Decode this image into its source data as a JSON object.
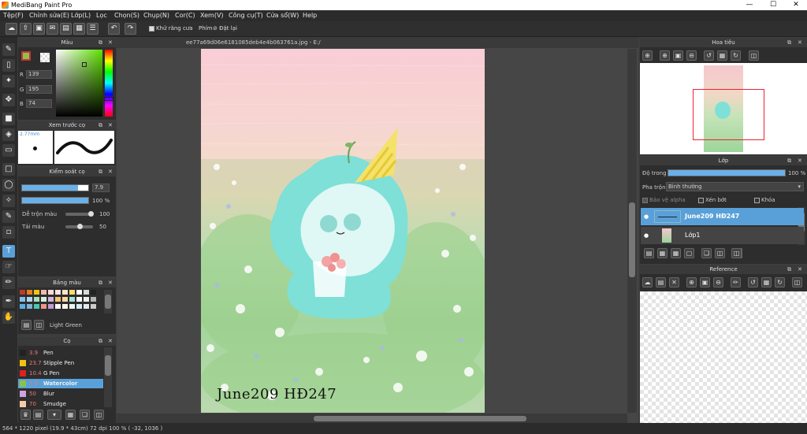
{
  "window": {
    "title": "MediBang Paint Pro"
  },
  "menu": [
    "Tệp(F)",
    "Chỉnh sửa(E)",
    "Lớp(L)",
    "Lọc",
    "Chọn(S)",
    "Chụp(N)",
    "Cor(C)",
    "Xem(V)",
    "Công cụ(T)",
    "Cửa sổ(W)",
    "Help"
  ],
  "toolbar": {
    "antialias_label": "Khử răng cưa",
    "key_label": "Phím",
    "reset_label": "Đặt lại"
  },
  "document": {
    "tab_title": "ee77a69d06e6181085deb4e4b063761a.jpg - E:/"
  },
  "color_panel": {
    "title": "Màu",
    "r": "139",
    "g": "195",
    "b": "74",
    "r_label": "R",
    "g_label": "G",
    "b_label": "B",
    "current_color": "#8bc34a"
  },
  "brush_preview": {
    "title": "Xem trước cọ",
    "size": "2.77mm"
  },
  "brush_control": {
    "title": "Kiểm soát cọ",
    "size_value": "7.9",
    "opacity_value": "100 %",
    "blend_label": "Dễ trộn màu",
    "blend_value": "100",
    "reload_label": "Tải màu",
    "reload_value": "50",
    "size_fill": 0.85,
    "opacity_fill": 1.0
  },
  "palette": {
    "title": "Bảng màu",
    "selected_name": "Light Green",
    "colors": [
      "#c0392b",
      "#e67e22",
      "#f1c40f",
      "#f5b7b1",
      "#fadbd8",
      "#fde2e4",
      "#fbe7c6",
      "#f7dc6f",
      "#ffffff",
      "#d5d8dc",
      "#222222",
      "#85c1e9",
      "#aed6f1",
      "#a9dfbf",
      "#d4efdf",
      "#d2b4de",
      "#f8c471",
      "#fad7a0",
      "#a3e4d7",
      "#ffffff",
      "#eeeeee",
      "#b3b6b7",
      "#5dade2",
      "#7fb3d5",
      "#48c9b0",
      "#f1948a",
      "#c39bd3",
      "#f7f9f9",
      "#fef9e7",
      "#e8f8f5",
      "#d6eaf8",
      "#e5e7e9",
      "#cccccc"
    ]
  },
  "brushes": {
    "title": "Cọ",
    "items": [
      {
        "size": "3.9",
        "name": "Pen",
        "color": "#222222"
      },
      {
        "size": "23.7",
        "name": "Stipple Pen",
        "color": "#f1c40f"
      },
      {
        "size": "10.4",
        "name": "G Pen",
        "color": "#e02020"
      },
      {
        "size": "7.9",
        "name": "Watercolor",
        "color": "#8bc34a"
      },
      {
        "size": "50",
        "name": "Blur",
        "color": "#d0a0e0"
      },
      {
        "size": "70",
        "name": "Smudge",
        "color": "#f5cba7"
      }
    ],
    "selected_index": 3
  },
  "navigator": {
    "title": "Hoa tiêu"
  },
  "layers": {
    "title": "Lớp",
    "opacity_label": "Độ trong",
    "opacity_value": "100 %",
    "opacity_fill": 1.0,
    "blend_label": "Pha trộn",
    "blend_value": "Bình thường",
    "protect_alpha_label": "Bảo vệ alpha",
    "clipping_label": "Xén bớt",
    "lock_label": "Khóa",
    "items": [
      {
        "name": "June209 HĐ247",
        "selected": true
      },
      {
        "name": "Lớp1",
        "selected": false
      }
    ]
  },
  "reference": {
    "title": "Reference"
  },
  "artwork": {
    "signature": "June209 HĐ247"
  },
  "status": {
    "text": "564 * 1220 pixel   (19.9 * 43cm)  72 dpi  100 %  ( -32, 1036 )"
  }
}
